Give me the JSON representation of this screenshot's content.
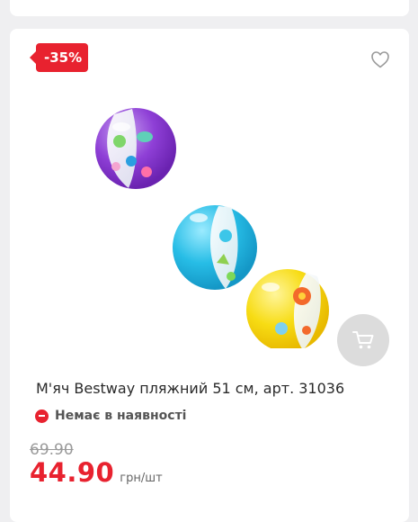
{
  "product": {
    "discount_badge": "-35%",
    "title": "М'яч Bestway пляжний 51 см, арт. 31036",
    "stock_status": "Немає в наявності",
    "old_price": "69.90",
    "price": "44.90",
    "price_unit": "грн/шт"
  },
  "colors": {
    "accent": "#e8222f",
    "card_bg": "#ffffff",
    "page_bg": "#efeff1",
    "cart_button_bg": "#dcdcdc"
  },
  "icons": {
    "favorite": "heart-icon",
    "cart": "cart-icon",
    "stock": "minus-circle-icon"
  }
}
